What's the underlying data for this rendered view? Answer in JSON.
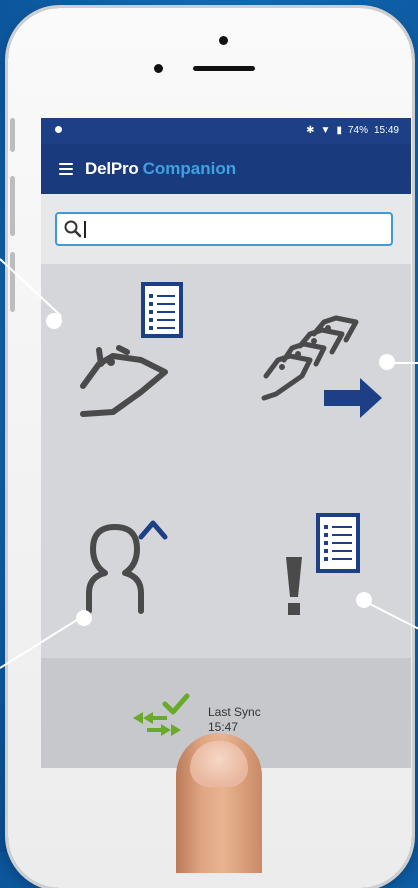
{
  "status_bar": {
    "battery_text": "74%",
    "time": "15:49"
  },
  "app_bar": {
    "brand_name": "DelPro",
    "brand_accent": "Companion"
  },
  "search": {
    "placeholder": "",
    "value": ""
  },
  "tiles": [
    {
      "icon": "cow-record-icon"
    },
    {
      "icon": "cow-move-icon"
    },
    {
      "icon": "user-home-icon"
    },
    {
      "icon": "alert-list-icon"
    }
  ],
  "sync": {
    "label": "Last Sync",
    "time": "15:47"
  },
  "colors": {
    "app_bar": "#1a3a7e",
    "accent": "#3ea1e2",
    "icon_blue": "#1c3f86",
    "icon_grey": "#4a4a4a",
    "sync_green": "#6aaa2a",
    "background": "#1474bf"
  }
}
